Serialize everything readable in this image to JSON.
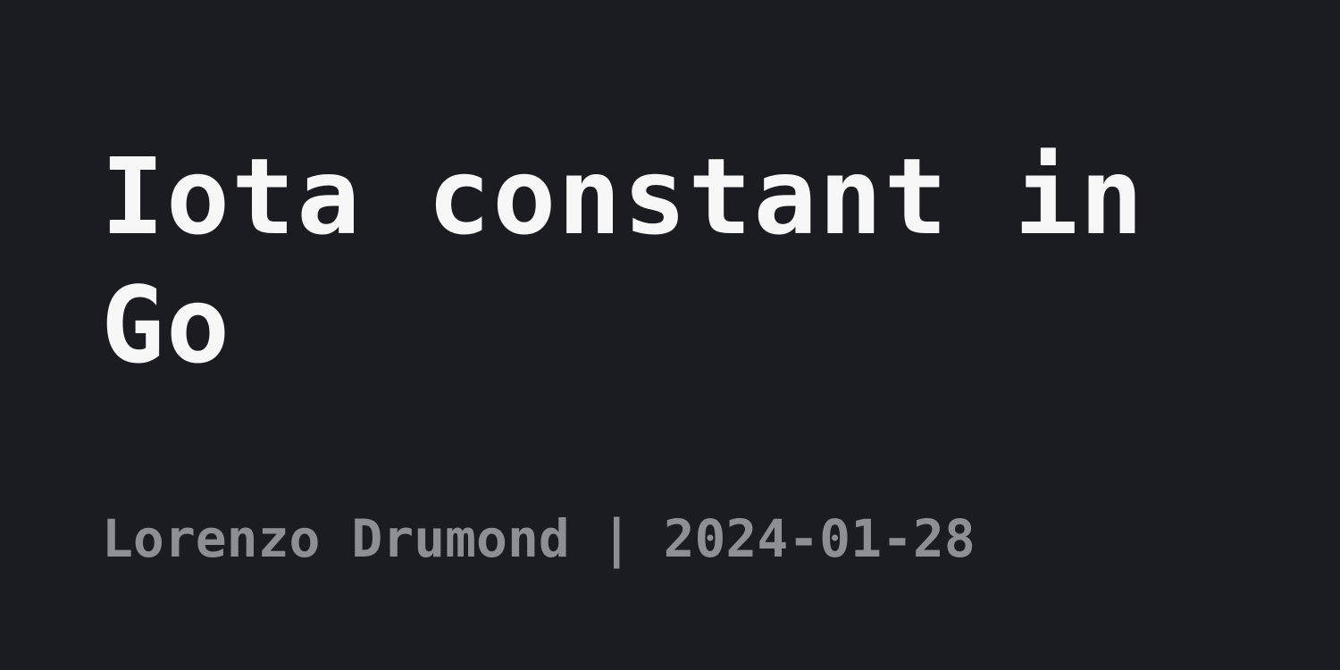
{
  "post": {
    "title": "Iota constant in Go",
    "author": "Lorenzo Drumond",
    "separator": "|",
    "date": "2024-01-28"
  },
  "colors": {
    "background": "#1b1c21",
    "title": "#f7f7f8",
    "meta": "#8e8f94"
  }
}
